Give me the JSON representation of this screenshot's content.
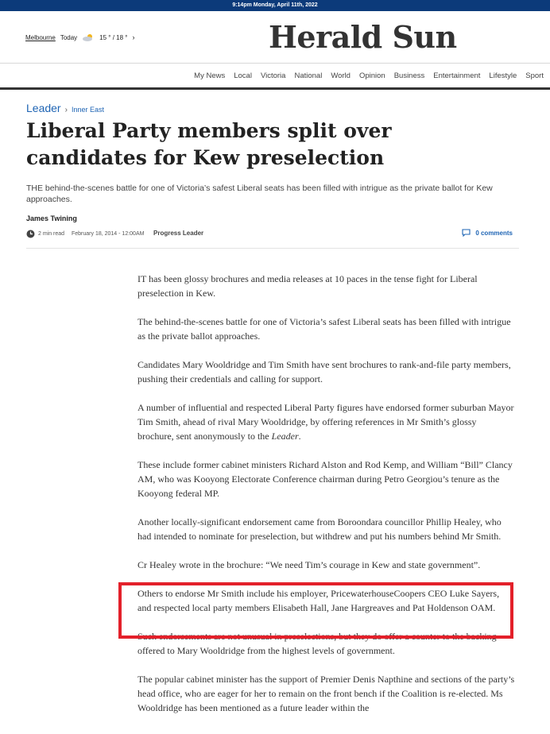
{
  "topbar": {
    "datetime": "9:14pm Monday, April 11th, 2022"
  },
  "weather": {
    "city": "Melbourne",
    "day": "Today",
    "temps": "15 ° / 18 °"
  },
  "brand": {
    "name": "Herald Sun"
  },
  "nav": {
    "items": [
      "My News",
      "Local",
      "Victoria",
      "National",
      "World",
      "Opinion",
      "Business",
      "Entertainment",
      "Lifestyle",
      "Sport"
    ]
  },
  "breadcrumb": {
    "section": "Leader",
    "separator": "›",
    "subsection": "Inner East"
  },
  "article": {
    "headline": "Liberal Party members split over candidates for Kew preselection",
    "standfirst": "THE behind-the-scenes battle for one of Victoria’s safest Liberal seats has been filled with intrigue as the private ballot for Kew approaches.",
    "author": "James Twining",
    "read_time": "2 min read",
    "date": "February 18, 2014 - 12:00AM",
    "source": "Progress Leader",
    "comments": "0 comments",
    "paragraphs": [
      "IT has been glossy brochures and media releases at 10 paces in the tense fight for Liberal preselection in Kew.",
      "The behind-the-scenes battle for one of Victoria’s safest Liberal seats has been filled with intrigue as the private ballot approaches.",
      "Candidates Mary Wooldridge and Tim Smith have sent brochures to rank-and-file party members, pushing their credentials and calling for support.",
      "A number of influential and respected Liberal Party figures have endorsed former suburban Mayor Tim Smith, ahead of rival Mary Wooldridge, by offering references in Mr Smith’s glossy brochure, sent anonymously to the Leader.",
      "These include former cabinet ministers Richard Alston and Rod Kemp, and William “Bill” Clancy AM, who was Kooyong Electorate Conference chairman during Petro Georgiou’s tenure as the Kooyong federal MP.",
      "Another locally-significant endorsement came from Boroondara councillor Phillip Healey, who had intended to nominate for preselection, but withdrew and put his numbers behind Mr Smith.",
      "Cr Healey wrote in the brochure: “We need Tim’s courage in Kew and state government”.",
      "Others to endorse Mr Smith include his employer, PricewaterhouseCoopers CEO Luke Sayers, and respected local party members Elisabeth Hall, Jane Hargreaves and Pat Holdenson OAM.",
      "Such endorsements are not unusual in preselections, but they do offer a counter to the backing offered to Mary Wooldridge from the highest levels of government.",
      "The popular cabinet minister has the support of Premier Denis Napthine and sections of the party’s head office, who are eager for her to remain on the front bench if the Coalition is re-elected. Ms Wooldridge has been mentioned as a future leader within the"
    ]
  },
  "colors": {
    "topbar": "#0c3a7a",
    "link": "#1e64b4",
    "highlight": "#e3202a"
  },
  "icons": [
    "cloud-sun-icon",
    "chevron-right-icon",
    "clock-icon",
    "comment-icon"
  ]
}
